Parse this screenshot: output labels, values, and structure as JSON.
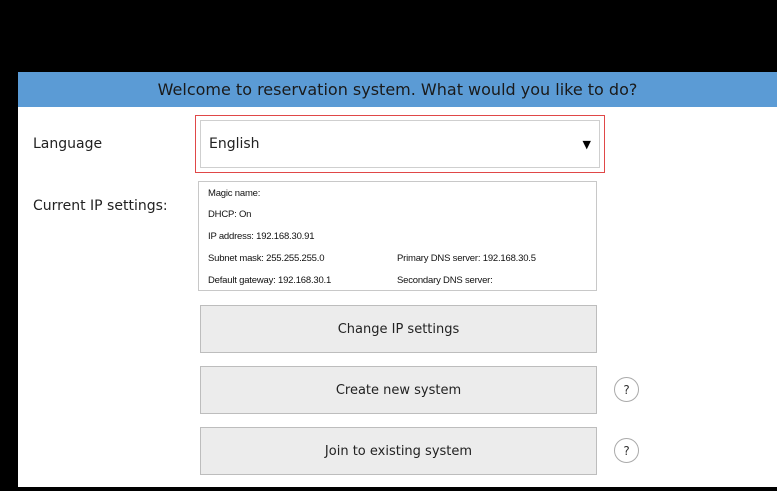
{
  "header": {
    "title": "Welcome to reservation system. What would you like to do?"
  },
  "language": {
    "label": "Language",
    "selected": "English"
  },
  "ip_settings": {
    "label": "Current IP settings:",
    "magic_name": "Magic name:",
    "dhcp": "DHCP: On",
    "ip_address": "IP address: 192.168.30.91",
    "subnet_mask": "Subnet mask: 255.255.255.0",
    "primary_dns": "Primary DNS server: 192.168.30.5",
    "default_gateway": "Default gateway: 192.168.30.1",
    "secondary_dns": "Secondary DNS server:"
  },
  "buttons": {
    "change_ip": "Change IP settings",
    "create_system": "Create new system",
    "join_system": "Join to existing system"
  },
  "help": {
    "symbol": "?"
  },
  "colors": {
    "header_bg": "#5b9bd5",
    "focus_border": "#e04848",
    "button_bg": "#ececec"
  }
}
